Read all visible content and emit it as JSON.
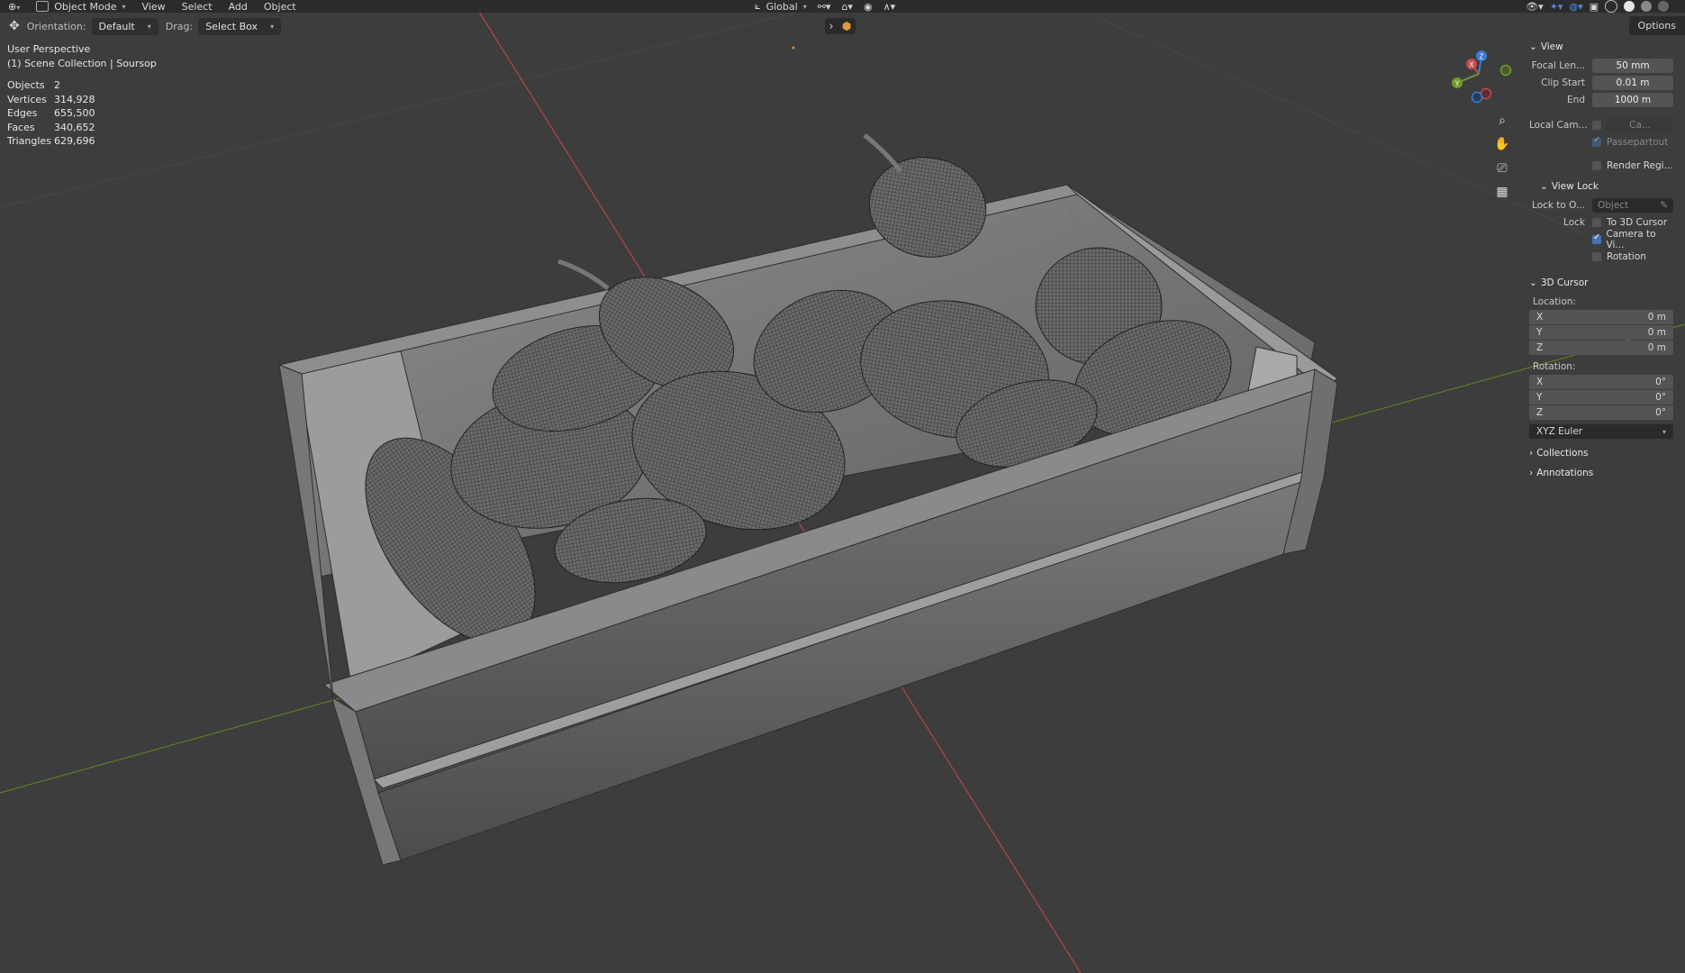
{
  "header": {
    "mode": "Object Mode",
    "menus": [
      "View",
      "Select",
      "Add",
      "Object"
    ],
    "transform_orientation": "Global"
  },
  "toolbar": {
    "orientation_label": "Orientation:",
    "orientation_value": "Default",
    "drag_label": "Drag:",
    "drag_value": "Select Box",
    "options": "Options"
  },
  "viewport": {
    "perspective": "User Perspective",
    "collection": "(1) Scene Collection | Soursop",
    "stats": [
      {
        "k": "Objects",
        "v": "2"
      },
      {
        "k": "Vertices",
        "v": "314,928"
      },
      {
        "k": "Edges",
        "v": "655,500"
      },
      {
        "k": "Faces",
        "v": "340,652"
      },
      {
        "k": "Triangles",
        "v": "629,696"
      }
    ]
  },
  "gizmo": {
    "x": "X",
    "y": "Y",
    "z": "Z"
  },
  "sidebar": {
    "view": {
      "title": "View",
      "focal_label": "Focal Len...",
      "focal_value": "50 mm",
      "clip_start_label": "Clip Start",
      "clip_start_value": "0.01 m",
      "end_label": "End",
      "end_value": "1000 m",
      "local_cam_label": "Local Cam...",
      "local_cam_value": "Ca...",
      "passepartout": "Passepartout",
      "render_region": "Render Regi..."
    },
    "view_lock": {
      "title": "View Lock",
      "lock_to_label": "Lock to O...",
      "lock_to_placeholder": "Object",
      "lock_label": "Lock",
      "to_3d_cursor": "To 3D Cursor",
      "camera_to_view": "Camera to Vi...",
      "rotation": "Rotation"
    },
    "cursor": {
      "title": "3D Cursor",
      "location_label": "Location:",
      "loc": [
        {
          "axis": "X",
          "v": "0 m"
        },
        {
          "axis": "Y",
          "v": "0 m"
        },
        {
          "axis": "Z",
          "v": "0 m"
        }
      ],
      "rotation_label": "Rotation:",
      "rot": [
        {
          "axis": "X",
          "v": "0°"
        },
        {
          "axis": "Y",
          "v": "0°"
        },
        {
          "axis": "Z",
          "v": "0°"
        }
      ],
      "rotation_mode": "XYZ Euler"
    },
    "collections": "Collections",
    "annotations": "Annotations"
  },
  "colors": {
    "background": "#3d3d3d",
    "x_axis": "#c84a4a",
    "y_axis": "#6f9a2c",
    "z_axis": "#3a7bd5",
    "accent": "#4772b3"
  }
}
